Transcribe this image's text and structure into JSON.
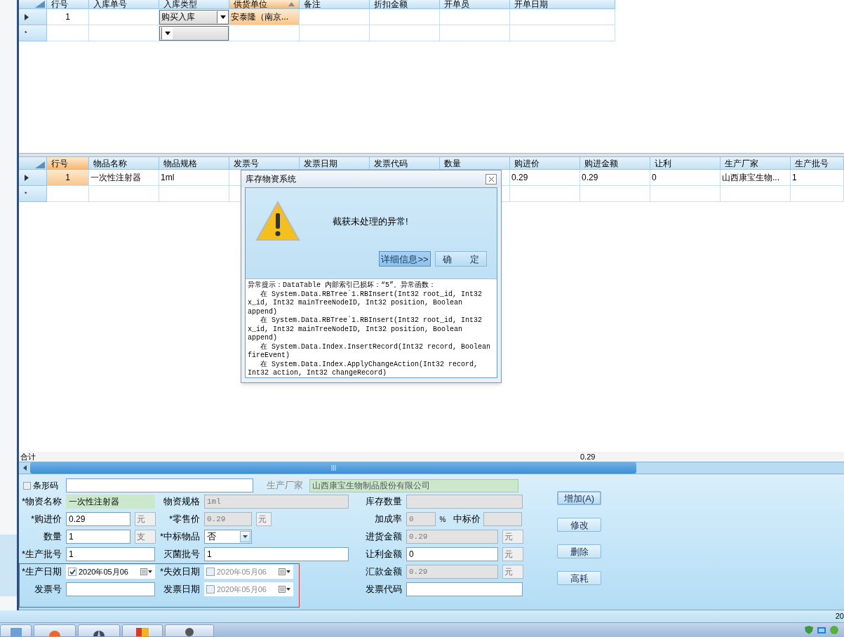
{
  "top_grid": {
    "columns": [
      {
        "label": "行号",
        "highlighted": false,
        "sorted": false
      },
      {
        "label": "入库单号",
        "highlighted": false,
        "sorted": false
      },
      {
        "label": "入库类型",
        "highlighted": false,
        "sorted": false
      },
      {
        "label": "供货单位",
        "highlighted": true,
        "sorted": true
      },
      {
        "label": "备注",
        "highlighted": false,
        "sorted": false
      },
      {
        "label": "折扣金额",
        "highlighted": false,
        "sorted": false
      },
      {
        "label": "开单员",
        "highlighted": false,
        "sorted": false
      },
      {
        "label": "开单日期",
        "highlighted": false,
        "sorted": false
      }
    ],
    "rows": [
      {
        "kind": "data",
        "cells": [
          {
            "kind": "number",
            "text": "1"
          },
          {
            "kind": "text"
          },
          {
            "kind": "combo",
            "text": "购买入库"
          },
          {
            "kind": "text",
            "text": "安泰隆（南京...",
            "current": true
          },
          {
            "kind": "text"
          },
          {
            "kind": "text"
          },
          {
            "kind": "text"
          },
          {
            "kind": "text"
          }
        ]
      },
      {
        "kind": "new",
        "marker": "*",
        "cells": [
          {
            "kind": "text"
          },
          {
            "kind": "text"
          },
          {
            "kind": "combo"
          },
          {
            "kind": "text"
          },
          {
            "kind": "text"
          },
          {
            "kind": "text"
          },
          {
            "kind": "text"
          },
          {
            "kind": "text"
          }
        ]
      }
    ]
  },
  "detail_grid": {
    "columns": [
      {
        "label": "行号",
        "highlighted": true,
        "sorted": false
      },
      {
        "label": "物品名称",
        "highlighted": false,
        "sorted": false
      },
      {
        "label": "物品规格",
        "highlighted": false,
        "sorted": false
      },
      {
        "label": "发票号",
        "highlighted": false,
        "sorted": false
      },
      {
        "label": "发票日期",
        "highlighted": false,
        "sorted": false
      },
      {
        "label": "发票代码",
        "highlighted": false,
        "sorted": false
      },
      {
        "label": "数量",
        "highlighted": false,
        "sorted": false
      },
      {
        "label": "购进价",
        "highlighted": false,
        "sorted": false
      },
      {
        "label": "购进金额",
        "highlighted": false,
        "sorted": false
      },
      {
        "label": "让利",
        "highlighted": false,
        "sorted": false
      },
      {
        "label": "生产厂家",
        "highlighted": false,
        "sorted": false
      },
      {
        "label": "生产批号",
        "highlighted": false,
        "sorted": false
      }
    ],
    "rows": [
      {
        "kind": "data",
        "cells": [
          {
            "kind": "number",
            "text": "1",
            "current": true
          },
          {
            "kind": "text",
            "text": "一次性注射器"
          },
          {
            "kind": "text",
            "text": "1ml"
          },
          {
            "kind": "text"
          },
          {
            "kind": "text"
          },
          {
            "kind": "text"
          },
          {
            "kind": "text"
          },
          {
            "kind": "text",
            "text": "0.29"
          },
          {
            "kind": "text",
            "text": "0.29"
          },
          {
            "kind": "text",
            "text": "0"
          },
          {
            "kind": "text",
            "text": "山西康宝生物..."
          },
          {
            "kind": "text",
            "text": "1"
          }
        ]
      },
      {
        "kind": "new",
        "marker": "*",
        "cells": [
          {
            "kind": "text"
          },
          {
            "kind": "text"
          },
          {
            "kind": "text"
          },
          {
            "kind": "text"
          },
          {
            "kind": "text"
          },
          {
            "kind": "text"
          },
          {
            "kind": "text"
          },
          {
            "kind": "text"
          },
          {
            "kind": "text"
          },
          {
            "kind": "text"
          },
          {
            "kind": "text"
          },
          {
            "kind": "text"
          }
        ]
      }
    ],
    "total": {
      "label": "合计",
      "value": "0.29"
    }
  },
  "form": {
    "barcode": {
      "label": "条形码",
      "checked": false
    },
    "manufacturer": {
      "label": "生产厂家",
      "value": "山西康宝生物制品股份有限公司",
      "readonly": true
    },
    "columns": [
      [
        {
          "kind": "text",
          "label": "*物资名称",
          "value": "一次性注射器",
          "readonly": true,
          "disabled": false
        },
        {
          "kind": "unit",
          "label": "*购进价",
          "value": "0.29",
          "unit": "元",
          "disabled": false
        },
        {
          "kind": "unit",
          "label": "数量",
          "value": "1",
          "unit": "支",
          "disabled": false
        },
        {
          "kind": "text",
          "label": "*生产批号",
          "value": "1",
          "disabled": false
        },
        {
          "kind": "date",
          "label": "*生产日期",
          "value": "2020年05月06",
          "checked": true
        },
        {
          "kind": "text",
          "label": "发票号",
          "disabled": false
        }
      ],
      [
        {
          "kind": "text",
          "label": "物资规格",
          "value": "1ml",
          "disabled": true
        },
        {
          "kind": "unit",
          "label": "*零售价",
          "value": "0.29",
          "unit": "元",
          "disabled": true
        },
        {
          "kind": "combo",
          "label": "*中标物品",
          "value": "否"
        },
        {
          "kind": "text",
          "label": "灭菌批号",
          "value": "1",
          "disabled": false
        },
        {
          "kind": "date",
          "label": "*失效日期",
          "value": "2020年05月06",
          "checked": false
        },
        {
          "kind": "date",
          "label": "发票日期",
          "value": "2020年05月06",
          "checked": false
        }
      ],
      [
        {
          "kind": "text",
          "label": "库存数量",
          "disabled": true
        },
        {
          "kind": "rate",
          "label": "加成率",
          "value": "0",
          "unit": "%",
          "label2": "中标价",
          "disabled": true
        },
        {
          "kind": "unit",
          "label": "进货金额",
          "value": "0.29",
          "unit": "元",
          "disabled": true
        },
        {
          "kind": "unit",
          "label": "让利金额",
          "value": "0",
          "unit": "元",
          "disabled": false
        },
        {
          "kind": "unit",
          "label": "汇款金额",
          "value": "0.29",
          "unit": "元",
          "disabled": true
        },
        {
          "kind": "text",
          "label": "发票代码",
          "disabled": false
        }
      ]
    ],
    "buttons": [
      {
        "label": "增加(A)",
        "default": true
      },
      {
        "label": "修改",
        "default": false
      },
      {
        "label": "删除",
        "default": false
      },
      {
        "label": "高耗",
        "default": false
      }
    ]
  },
  "status_bar": {
    "text": "20"
  },
  "dialog": {
    "title": "库存物资系统",
    "message": "截获未处理的异常!",
    "buttons": [
      {
        "label": "详细信息>>",
        "pressed": true
      },
      {
        "label": "确　　定",
        "pressed": false
      }
    ],
    "details": [
      "异常提示：DataTable 内部索引已损坏：“5”。异常函数：",
      "   在 System.Data.RBTree`1.RBInsert(Int32 root_id, Int32",
      "x_id, Int32 mainTreeNodeID, Int32 position, Boolean",
      "append)",
      "   在 System.Data.RBTree`1.RBInsert(Int32 root_id, Int32",
      "x_id, Int32 mainTreeNodeID, Int32 position, Boolean",
      "append)",
      "   在 System.Data.Index.InsertRecord(Int32 record, Boolean",
      "fireEvent)",
      "   在 System.Data.Index.ApplyChangeAction(Int32 record,",
      "Int32 action, Int32 changeRecord)"
    ]
  }
}
